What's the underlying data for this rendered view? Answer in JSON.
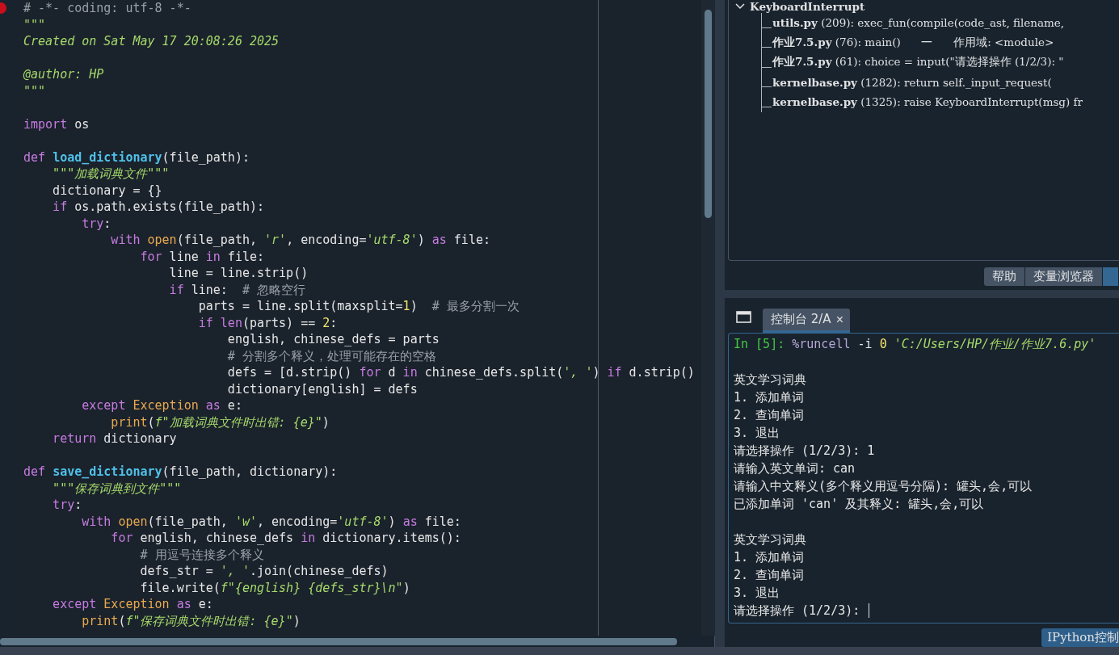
{
  "editor": {
    "lines": [
      {
        "kind": "code",
        "breakpoint": true,
        "tokens": [
          {
            "kind": "comment",
            "text": "# -*- coding: utf-8 -*-"
          }
        ]
      },
      {
        "kind": "code",
        "tokens": [
          {
            "kind": "doc",
            "text": "\"\"\""
          }
        ]
      },
      {
        "kind": "code",
        "tokens": [
          {
            "kind": "doc",
            "text": "Created on Sat May 17 20:08:26 2025"
          }
        ]
      },
      {
        "kind": "blank"
      },
      {
        "kind": "code",
        "tokens": [
          {
            "kind": "doc",
            "text": "@author: HP"
          }
        ]
      },
      {
        "kind": "code",
        "tokens": [
          {
            "kind": "doc",
            "text": "\"\"\""
          }
        ]
      },
      {
        "kind": "blank"
      },
      {
        "kind": "code",
        "tokens": [
          {
            "kind": "kw",
            "text": "import"
          },
          {
            "kind": "plain",
            "text": " os"
          }
        ]
      },
      {
        "kind": "blank"
      },
      {
        "kind": "code",
        "tokens": [
          {
            "kind": "kw",
            "text": "def "
          },
          {
            "kind": "fn",
            "text": "load_dictionary"
          },
          {
            "kind": "plain",
            "text": "(file_path):"
          }
        ]
      },
      {
        "kind": "code",
        "tokens": [
          {
            "kind": "doc",
            "text": "    \"\"\"加载词典文件\"\"\""
          }
        ]
      },
      {
        "kind": "code",
        "tokens": [
          {
            "kind": "plain",
            "text": "    dictionary = {}"
          }
        ]
      },
      {
        "kind": "code",
        "tokens": [
          {
            "kind": "kw",
            "text": "    if"
          },
          {
            "kind": "plain",
            "text": " os.path.exists(file_path):"
          }
        ]
      },
      {
        "kind": "code",
        "tokens": [
          {
            "kind": "kw",
            "text": "        try"
          },
          {
            "kind": "plain",
            "text": ":"
          }
        ]
      },
      {
        "kind": "code",
        "tokens": [
          {
            "kind": "kw",
            "text": "            with "
          },
          {
            "kind": "builtin",
            "text": "open"
          },
          {
            "kind": "plain",
            "text": "(file_path, "
          },
          {
            "kind": "str",
            "text": "'r'"
          },
          {
            "kind": "plain",
            "text": ", encoding="
          },
          {
            "kind": "str",
            "text": "'utf-8'"
          },
          {
            "kind": "plain",
            "text": ") "
          },
          {
            "kind": "kw",
            "text": "as"
          },
          {
            "kind": "plain",
            "text": " file:"
          }
        ]
      },
      {
        "kind": "code",
        "tokens": [
          {
            "kind": "kw",
            "text": "                for"
          },
          {
            "kind": "plain",
            "text": " line "
          },
          {
            "kind": "kw",
            "text": "in"
          },
          {
            "kind": "plain",
            "text": " file:"
          }
        ]
      },
      {
        "kind": "code",
        "tokens": [
          {
            "kind": "plain",
            "text": "                    line = line.strip()"
          }
        ]
      },
      {
        "kind": "code",
        "tokens": [
          {
            "kind": "kw",
            "text": "                    if"
          },
          {
            "kind": "plain",
            "text": " line:  "
          },
          {
            "kind": "comment",
            "text": "# 忽略空行"
          }
        ]
      },
      {
        "kind": "code",
        "tokens": [
          {
            "kind": "plain",
            "text": "                        parts = line.split(maxsplit="
          },
          {
            "kind": "num",
            "text": "1"
          },
          {
            "kind": "plain",
            "text": ")  "
          },
          {
            "kind": "comment",
            "text": "# 最多分割一次"
          }
        ]
      },
      {
        "kind": "code",
        "tokens": [
          {
            "kind": "kw",
            "text": "                        if len"
          },
          {
            "kind": "plain",
            "text": "(parts) == "
          },
          {
            "kind": "num",
            "text": "2"
          },
          {
            "kind": "plain",
            "text": ":"
          }
        ]
      },
      {
        "kind": "code",
        "tokens": [
          {
            "kind": "plain",
            "text": "                            english, chinese_defs = parts"
          }
        ]
      },
      {
        "kind": "code",
        "tokens": [
          {
            "kind": "comment",
            "text": "                            # 分割多个释义，处理可能存在的空格"
          }
        ]
      },
      {
        "kind": "code",
        "tokens": [
          {
            "kind": "plain",
            "text": "                            defs = [d.strip() "
          },
          {
            "kind": "kw",
            "text": "for"
          },
          {
            "kind": "plain",
            "text": " d "
          },
          {
            "kind": "kw",
            "text": "in"
          },
          {
            "kind": "plain",
            "text": " chinese_defs.split("
          },
          {
            "kind": "str",
            "text": "', '"
          },
          {
            "kind": "plain",
            "text": ") "
          },
          {
            "kind": "kw",
            "text": "if"
          },
          {
            "kind": "plain",
            "text": " d.strip()"
          }
        ]
      },
      {
        "kind": "code",
        "tokens": [
          {
            "kind": "plain",
            "text": "                            dictionary[english] = defs"
          }
        ]
      },
      {
        "kind": "code",
        "tokens": [
          {
            "kind": "kw",
            "text": "        except "
          },
          {
            "kind": "cls",
            "text": "Exception "
          },
          {
            "kind": "kw",
            "text": "as"
          },
          {
            "kind": "plain",
            "text": " e:"
          }
        ]
      },
      {
        "kind": "code",
        "tokens": [
          {
            "kind": "builtin",
            "text": "            print"
          },
          {
            "kind": "plain",
            "text": "("
          },
          {
            "kind": "str",
            "text": "f\"加载词典文件时出错: {e}\""
          },
          {
            "kind": "plain",
            "text": ")"
          }
        ]
      },
      {
        "kind": "code",
        "tokens": [
          {
            "kind": "kw",
            "text": "    return"
          },
          {
            "kind": "plain",
            "text": " dictionary"
          }
        ]
      },
      {
        "kind": "blank"
      },
      {
        "kind": "code",
        "tokens": [
          {
            "kind": "kw",
            "text": "def "
          },
          {
            "kind": "fn",
            "text": "save_dictionary"
          },
          {
            "kind": "plain",
            "text": "(file_path, dictionary):"
          }
        ]
      },
      {
        "kind": "code",
        "tokens": [
          {
            "kind": "doc",
            "text": "    \"\"\"保存词典到文件\"\"\""
          }
        ]
      },
      {
        "kind": "code",
        "tokens": [
          {
            "kind": "kw",
            "text": "    try"
          },
          {
            "kind": "plain",
            "text": ":"
          }
        ]
      },
      {
        "kind": "code",
        "tokens": [
          {
            "kind": "kw",
            "text": "        with "
          },
          {
            "kind": "builtin",
            "text": "open"
          },
          {
            "kind": "plain",
            "text": "(file_path, "
          },
          {
            "kind": "str",
            "text": "'w'"
          },
          {
            "kind": "plain",
            "text": ", encoding="
          },
          {
            "kind": "str",
            "text": "'utf-8'"
          },
          {
            "kind": "plain",
            "text": ") "
          },
          {
            "kind": "kw",
            "text": "as"
          },
          {
            "kind": "plain",
            "text": " file:"
          }
        ]
      },
      {
        "kind": "code",
        "tokens": [
          {
            "kind": "kw",
            "text": "            for"
          },
          {
            "kind": "plain",
            "text": " english, chinese_defs "
          },
          {
            "kind": "kw",
            "text": "in"
          },
          {
            "kind": "plain",
            "text": " dictionary.items():"
          }
        ]
      },
      {
        "kind": "code",
        "tokens": [
          {
            "kind": "comment",
            "text": "                # 用逗号连接多个释义"
          }
        ]
      },
      {
        "kind": "code",
        "tokens": [
          {
            "kind": "plain",
            "text": "                defs_str = "
          },
          {
            "kind": "str",
            "text": "', '"
          },
          {
            "kind": "plain",
            "text": ".join(chinese_defs)"
          }
        ]
      },
      {
        "kind": "code",
        "tokens": [
          {
            "kind": "plain",
            "text": "                file.write("
          },
          {
            "kind": "str",
            "text": "f\"{english} {defs_str}\\n\""
          },
          {
            "kind": "plain",
            "text": ")"
          }
        ]
      },
      {
        "kind": "code",
        "tokens": [
          {
            "kind": "kw",
            "text": "    except "
          },
          {
            "kind": "cls",
            "text": "Exception "
          },
          {
            "kind": "kw",
            "text": "as"
          },
          {
            "kind": "plain",
            "text": " e:"
          }
        ]
      },
      {
        "kind": "code",
        "tokens": [
          {
            "kind": "builtin",
            "text": "        print"
          },
          {
            "kind": "plain",
            "text": "("
          },
          {
            "kind": "str",
            "text": "f\"保存词典文件时出错: {e}\""
          },
          {
            "kind": "plain",
            "text": ")"
          }
        ]
      }
    ]
  },
  "traceback": {
    "title": "KeyboardInterrupt",
    "expanded": true,
    "frames": [
      "**utils.py** (209): exec_fun(compile(code_ast, filename,",
      "**作业7.5.py** (76): main()      一      作用域: <module>",
      "**作业7.5.py** (61): choice = input(\"请选择操作 (1/2/3): \"",
      "**kernelbase.py** (1282): return self._input_request(",
      "**kernelbase.py** (1325): raise KeyboardInterrupt(msg) fr"
    ]
  },
  "pane_tabs": [
    {
      "label": "帮助",
      "selected": false
    },
    {
      "label": "变量浏览器",
      "selected": false
    },
    {
      "selected": true
    }
  ],
  "console_tabs": [
    {
      "label": "控制台 2/A",
      "selected": true,
      "close": "×"
    }
  ],
  "console": {
    "cursor": true,
    "lines": [
      {
        "kind": "code",
        "tokens": [
          {
            "kind": "prompt",
            "text": "In [5]: "
          },
          {
            "kind": "magic",
            "text": "%runcell"
          },
          {
            "kind": "plain",
            "text": " -i "
          },
          {
            "kind": "num",
            "text": "0"
          },
          {
            "kind": "str",
            "text": " 'C:/Users/HP/作业/作业7.6.py'"
          }
        ]
      },
      {
        "kind": "blank"
      },
      {
        "kind": "code",
        "tokens": [
          {
            "kind": "plain",
            "text": "英文学习词典"
          }
        ]
      },
      {
        "kind": "code",
        "tokens": [
          {
            "kind": "plain",
            "text": "1. 添加单词"
          }
        ]
      },
      {
        "kind": "code",
        "tokens": [
          {
            "kind": "plain",
            "text": "2. 查询单词"
          }
        ]
      },
      {
        "kind": "code",
        "tokens": [
          {
            "kind": "plain",
            "text": "3. 退出"
          }
        ]
      },
      {
        "kind": "code",
        "tokens": [
          {
            "kind": "plain",
            "text": "请选择操作 (1/2/3): 1"
          }
        ]
      },
      {
        "kind": "code",
        "tokens": [
          {
            "kind": "plain",
            "text": "请输入英文单词: can"
          }
        ]
      },
      {
        "kind": "code",
        "tokens": [
          {
            "kind": "plain",
            "text": "请输入中文释义(多个释义用逗号分隔): 罐头,会,可以"
          }
        ]
      },
      {
        "kind": "code",
        "tokens": [
          {
            "kind": "plain",
            "text": "已添加单词 'can' 及其释义: 罐头,会,可以"
          }
        ]
      },
      {
        "kind": "blank"
      },
      {
        "kind": "code",
        "tokens": [
          {
            "kind": "plain",
            "text": "英文学习词典"
          }
        ]
      },
      {
        "kind": "code",
        "tokens": [
          {
            "kind": "plain",
            "text": "1. 添加单词"
          }
        ]
      },
      {
        "kind": "code",
        "tokens": [
          {
            "kind": "plain",
            "text": "2. 查询单词"
          }
        ]
      },
      {
        "kind": "code",
        "tokens": [
          {
            "kind": "plain",
            "text": "3. 退出"
          }
        ]
      },
      {
        "kind": "code",
        "tokens": [
          {
            "kind": "plain",
            "text": "请选择操作 (1/2/3): "
          }
        ]
      }
    ]
  },
  "bottom_tab": {
    "label": "IPython控制"
  }
}
